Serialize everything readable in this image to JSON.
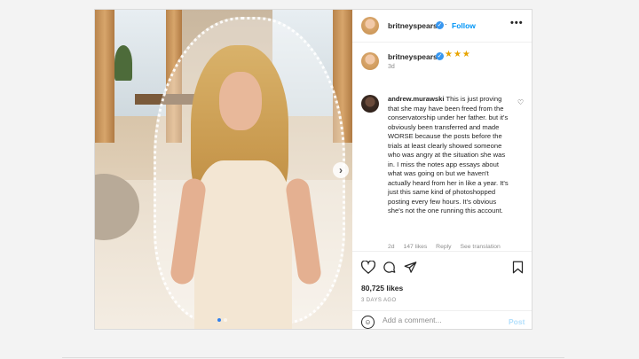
{
  "post": {
    "username": "britneyspears",
    "follow_label": "Follow",
    "more_label": "•••",
    "caption_stars": "★★★",
    "caption_time": "3d",
    "comment": {
      "username": "andrew.murawski",
      "text": "This is just proving that she may have been freed from the conservatorship under her father. but it's obviously been transferred and made WORSE because the posts before the trials at least clearly showed someone who was angry at the situation she was in. I miss the notes app essays about what was going on but we haven't actually heard from her in like a year. It's just this same kind of photoshopped posting every few hours. It's obvious she's not the one running this account.",
      "time": "2d",
      "likes": "147 likes",
      "reply": "Reply",
      "translation": "See translation"
    },
    "likes_count": "80,725 likes",
    "posted_ago": "3 DAYS AGO",
    "add_comment_placeholder": "Add a comment...",
    "post_label": "Post",
    "icons": {
      "like": "heart-icon",
      "comment": "comment-icon",
      "share": "share-icon",
      "save": "bookmark-icon",
      "emoji": "emoji-icon",
      "next": "chevron-right-icon",
      "verified": "verified-badge-icon"
    }
  },
  "colors": {
    "link": "#0095f6",
    "verified": "#3897f0",
    "muted": "#8e8e8e",
    "border": "#dbdbdb"
  }
}
